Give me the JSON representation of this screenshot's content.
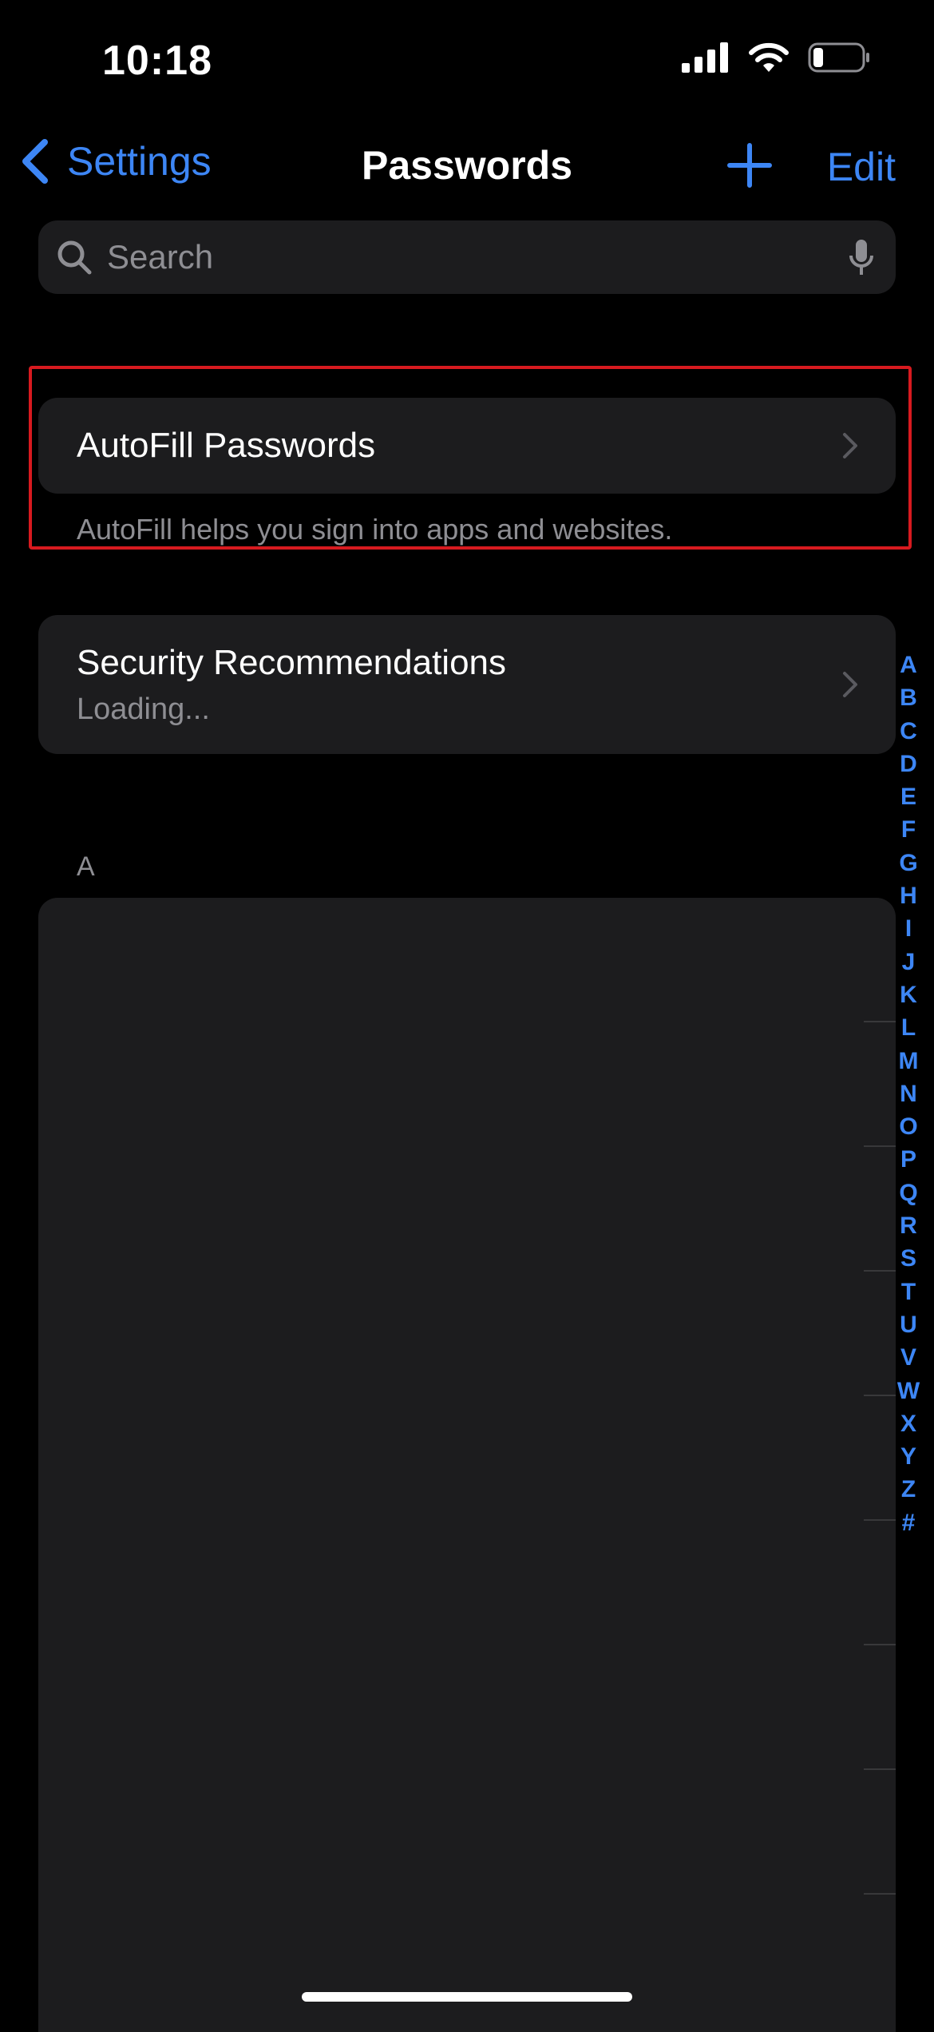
{
  "status_bar": {
    "time": "10:18",
    "battery_level": 0.2
  },
  "nav": {
    "back_label": "Settings",
    "title": "Passwords",
    "edit_label": "Edit"
  },
  "search": {
    "placeholder": "Search"
  },
  "autofill": {
    "label": "AutoFill Passwords",
    "footer": "AutoFill helps you sign into apps and websites."
  },
  "security": {
    "label": "Security Recommendations",
    "status": "Loading..."
  },
  "section": {
    "header": "A"
  },
  "index_letters": [
    "A",
    "B",
    "C",
    "D",
    "E",
    "F",
    "G",
    "H",
    "I",
    "J",
    "K",
    "L",
    "M",
    "N",
    "O",
    "P",
    "Q",
    "R",
    "S",
    "T",
    "U",
    "V",
    "W",
    "X",
    "Y",
    "Z",
    "#"
  ],
  "colors": {
    "accent": "#3d86f5",
    "highlight": "#d71a1f",
    "cell": "#1c1c1e",
    "background": "#000000"
  }
}
